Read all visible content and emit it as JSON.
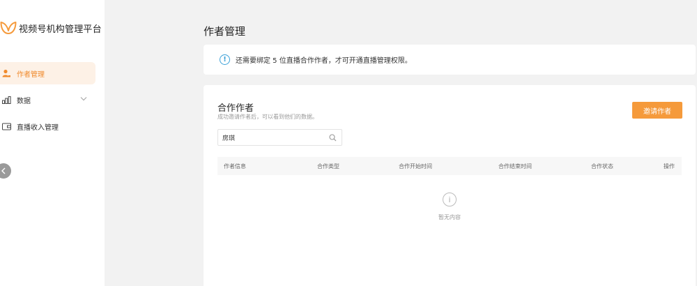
{
  "app": {
    "title": "视频号机构管理平台"
  },
  "sidebar": {
    "items": [
      {
        "label": "作者管理",
        "icon": "user-icon",
        "active": true
      },
      {
        "label": "数据",
        "icon": "bar-chart-icon",
        "active": false,
        "expandable": true
      },
      {
        "label": "直播收入管理",
        "icon": "wallet-icon",
        "active": false
      }
    ]
  },
  "page": {
    "title": "作者管理"
  },
  "notice": {
    "text": "还需要绑定 5 位直播合作作者，才可开通直播管理权限。",
    "icon": "info-icon"
  },
  "card": {
    "title": "合作作者",
    "subtitle": "成功邀请作者后，可以看到他们的数据。",
    "invite_button": "邀请作者",
    "search": {
      "value": "房琪",
      "icon": "search-icon"
    },
    "columns": [
      "作者信息",
      "合作类型",
      "合作开始时间",
      "合作结束时间",
      "合作状态",
      "操作"
    ],
    "empty_text": "暂无内容"
  },
  "colors": {
    "accent": "#f59a3b",
    "active_bg": "#fdf1e6",
    "active_text": "#f08a2c",
    "info": "#3aa0d8",
    "page_bg": "#f2f2f2"
  }
}
